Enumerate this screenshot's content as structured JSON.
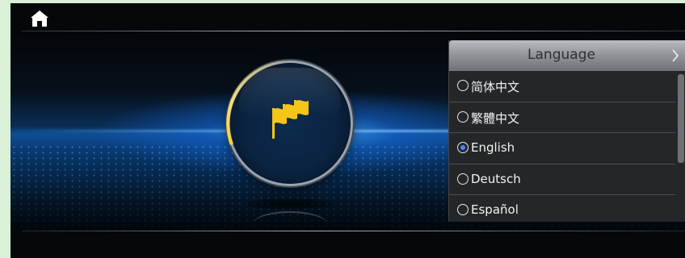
{
  "language_panel": {
    "title": "Language",
    "chevron_icon": "chevron-right-icon",
    "options": [
      {
        "label": "简体中文",
        "selected": false
      },
      {
        "label": "繁體中文",
        "selected": false
      },
      {
        "label": "English",
        "selected": true
      },
      {
        "label": "Deutsch",
        "selected": false
      },
      {
        "label": "Español",
        "selected": false
      }
    ]
  },
  "icons": {
    "home": "home-icon",
    "feature": "flags-icon"
  },
  "colors": {
    "accent_blue": "#3d8cff",
    "icon_yellow": "#f5c518",
    "background": "#050709"
  }
}
